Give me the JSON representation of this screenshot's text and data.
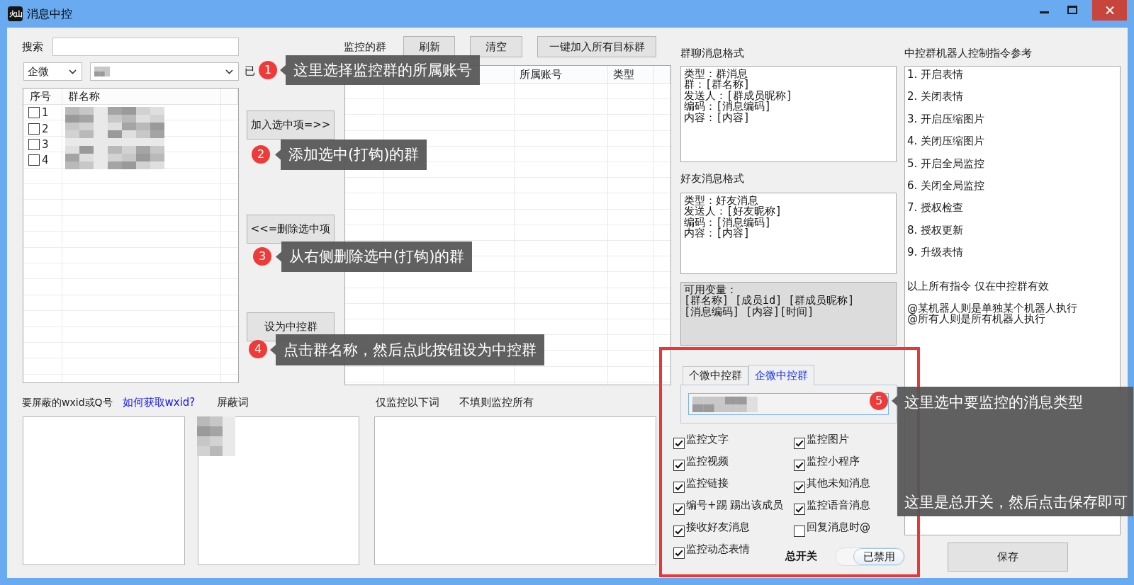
{
  "window": {
    "title": "消息中控",
    "app_icon_text": "火山"
  },
  "search": {
    "label": "搜索"
  },
  "account_filter": {
    "type_value": "企微",
    "selected_label": "已"
  },
  "group_list": {
    "columns": [
      "序号",
      "群名称"
    ],
    "rows": [
      {
        "number": "1",
        "checked": false
      },
      {
        "number": "2",
        "checked": false
      },
      {
        "number": "3",
        "checked": false
      },
      {
        "number": "4",
        "checked": false
      }
    ]
  },
  "move_buttons": [
    "加入选中项=>>",
    "<<=删除选中项",
    "设为中控群"
  ],
  "monitored_groups": {
    "label": "监控的群",
    "buttons": [
      "刷新",
      "清空",
      "一键加入所有目标群"
    ],
    "columns": [
      "所属账号",
      "类型"
    ]
  },
  "group_message_format": {
    "label": "群聊消息格式",
    "lines": [
      "类型：群消息",
      "群：[群名称]",
      "发送人：[群成员昵称]",
      "编码：[消息编码]",
      "内容：[内容]"
    ]
  },
  "friend_message_format": {
    "label": "好友消息格式",
    "lines": [
      "类型：好友消息",
      "发送人：[好友昵称]",
      "编码：[消息编码]",
      "内容：[内容]"
    ]
  },
  "variables": {
    "lines": [
      "可用变量：",
      "[群名称] [成员id] [群成员昵称]",
      "[消息编码] [内容][时间]"
    ]
  },
  "commands": {
    "label": "中控群机器人控制指令参考",
    "items": [
      "1. 开启表情",
      "2. 关闭表情",
      "3. 开启压缩图片",
      "4. 关闭压缩图片",
      "5. 开启全局监控",
      "6. 关闭全局监控",
      "7. 授权检查",
      "8. 授权更新",
      "9. 升级表情"
    ],
    "notes": [
      "以上所有指令 仅在中控群有效",
      "@某机器人则是单独某个机器人执行",
      "@所有人则是所有机器人执行"
    ]
  },
  "blocked_ids": {
    "label": "要屏蔽的wxid或Q号",
    "help_link": "如何获取wxid?"
  },
  "blocked_words": {
    "label": "屏蔽词"
  },
  "keyword_filter": {
    "labels": [
      "仅监控以下词",
      "不填则监控所有"
    ]
  },
  "control_group": {
    "tabs": [
      {
        "label": "个微中控群",
        "selected": false
      },
      {
        "label": "企微中控群",
        "selected": true
      }
    ]
  },
  "message_types": [
    {
      "label": "监控文字",
      "checked": true
    },
    {
      "label": "监控图片",
      "checked": true
    },
    {
      "label": "监控视频",
      "checked": true
    },
    {
      "label": "监控小程序",
      "checked": true
    },
    {
      "label": "监控链接",
      "checked": true
    },
    {
      "label": "其他未知消息",
      "checked": true
    },
    {
      "label": "编号+踢 踢出该成员",
      "checked": true
    },
    {
      "label": "监控语音消息",
      "checked": true
    },
    {
      "label": "接收好友消息",
      "checked": true
    },
    {
      "label": "回复消息时@",
      "checked": false
    },
    {
      "label": "监控动态表情",
      "checked": true
    }
  ],
  "master_switch": {
    "label": "总开关",
    "on": false,
    "state_text": "已禁用"
  },
  "save_button": "保存",
  "annotations": [
    {
      "number": "1",
      "lines": [
        "这里选择监控群的所属账号"
      ]
    },
    {
      "number": "2",
      "lines": [
        "添加选中(打钩)的群"
      ]
    },
    {
      "number": "3",
      "lines": [
        "从右侧删除选中(打钩)的群"
      ]
    },
    {
      "number": "4",
      "lines": [
        "点击群名称，然后点此按钮设为中控群"
      ]
    },
    {
      "number": "5",
      "lines": [
        "这里选中要监控的消息类型",
        "这里是总开关，然后点击保存即可"
      ]
    }
  ]
}
